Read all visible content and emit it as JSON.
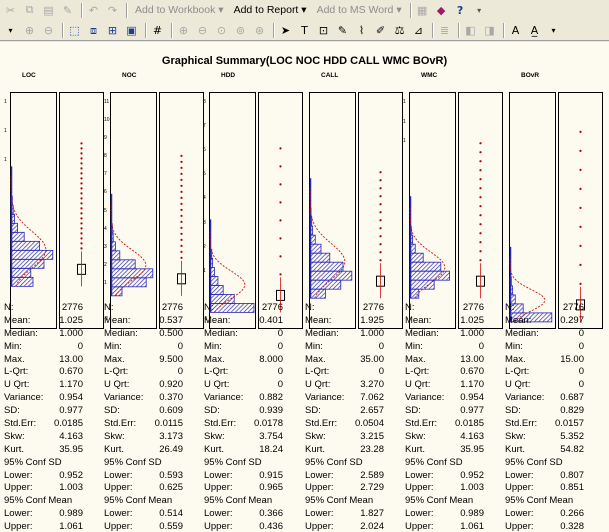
{
  "toolbar1": {
    "add_to_workbook": "Add to Workbook",
    "add_to_report": "Add to Report",
    "add_to_ms_word": "Add to MS Word"
  },
  "toolbar1_icons": [
    "cut-icon",
    "copy-icon",
    "paste-icon",
    "format-icon",
    "undo-icon",
    "redo-icon"
  ],
  "toolbar2_icons": [
    "dropdown-arrow-icon",
    "zoom-icon",
    "zoom-out-icon",
    "select-region-icon",
    "graph-icon",
    "graph-edit-icon",
    "grid-icon",
    "zoom-in-icon",
    "zoom-minus-icon",
    "zoom-fit-icon",
    "zoom-page-icon",
    "zoom-region-icon",
    "hash-icon",
    "pointer-icon",
    "text-icon",
    "insert-icon",
    "edit-icon",
    "brush-icon",
    "draw-icon",
    "scale-icon",
    "ruler-icon",
    "bars-icon",
    "layers-icon",
    "stack-icon",
    "font-up-icon",
    "font-down-icon"
  ],
  "graph": {
    "title": "Graphical Summary(LOC NOC HDD CALL WMC BOvR)",
    "colors": {
      "histogram": "#2727b8",
      "curve": "#d01010",
      "box": "#000000",
      "outlier": "#b00000"
    }
  },
  "panels": [
    {
      "label": "LOC",
      "ticks": [
        "1",
        "",
        "1",
        "",
        "1",
        "",
        "",
        "",
        "",
        "",
        "",
        "",
        "",
        "",
        "",
        ""
      ]
    },
    {
      "label": "NOC",
      "ticks": [
        "11",
        "10",
        "9",
        "8",
        "7",
        "6",
        "5",
        "4",
        "3",
        "2",
        "1",
        "",
        "-1"
      ]
    },
    {
      "label": "HDD",
      "ticks": [
        "8",
        "7",
        "6",
        "5",
        "4",
        "3",
        "2",
        "1",
        "",
        "-1"
      ]
    },
    {
      "label": "CALL",
      "ticks": [
        "",
        "",
        "",
        "",
        "",
        "",
        "",
        "",
        ""
      ]
    },
    {
      "label": "WMC",
      "ticks": [
        "1",
        "1",
        "1",
        "",
        "",
        "",
        "",
        "",
        "",
        "",
        "",
        ""
      ]
    },
    {
      "label": "BOvR",
      "ticks": [
        "",
        "",
        "",
        "",
        "",
        "",
        "",
        "",
        "",
        "",
        ""
      ]
    }
  ],
  "stat_labels": {
    "n": "N:",
    "mean": "Mean:",
    "median": "Median:",
    "min": "Min:",
    "max": "Max.",
    "lqrt": "L-Qrt:",
    "uqrt": "U Qrt:",
    "variance": "Variance:",
    "sd": "SD:",
    "stderr": "Std.Err:",
    "skw": "Skw:",
    "kurt": "Kurt.",
    "conf_sd": "95% Conf SD",
    "lower": "Lower:",
    "upper": "Upper:",
    "conf_mean": "95% Conf Mean"
  },
  "stats": [
    {
      "n": "2776",
      "mean": "1.025",
      "median": "1.000",
      "min": "0",
      "max": "13.00",
      "lqrt": "0.670",
      "uqrt": "1.170",
      "variance": "0.954",
      "sd": "0.977",
      "stderr": "0.0185",
      "skw": "4.163",
      "kurt": "35.95",
      "sd_lower": "0.952",
      "sd_upper": "1.003",
      "mean_lower": "0.989",
      "mean_upper": "1.061"
    },
    {
      "n": "2776",
      "mean": "0.537",
      "median": "0.500",
      "min": "0",
      "max": "9.500",
      "lqrt": "0",
      "uqrt": "0.920",
      "variance": "0.370",
      "sd": "0.609",
      "stderr": "0.0115",
      "skw": "3.173",
      "kurt": "26.49",
      "sd_lower": "0.593",
      "sd_upper": "0.625",
      "mean_lower": "0.514",
      "mean_upper": "0.559"
    },
    {
      "n": "2776",
      "mean": "0.401",
      "median": "0",
      "min": "0",
      "max": "8.000",
      "lqrt": "0",
      "uqrt": "0",
      "variance": "0.882",
      "sd": "0.939",
      "stderr": "0.0178",
      "skw": "3.754",
      "kurt": "18.24",
      "sd_lower": "0.915",
      "sd_upper": "0.965",
      "mean_lower": "0.366",
      "mean_upper": "0.436"
    },
    {
      "n": "2776",
      "mean": "1.925",
      "median": "1.000",
      "min": "0",
      "max": "35.00",
      "lqrt": "0",
      "uqrt": "3.270",
      "variance": "7.062",
      "sd": "2.657",
      "stderr": "0.0504",
      "skw": "3.215",
      "kurt": "23.28",
      "sd_lower": "2.589",
      "sd_upper": "2.729",
      "mean_lower": "1.827",
      "mean_upper": "2.024"
    },
    {
      "n": "2776",
      "mean": "1.025",
      "median": "1.000",
      "min": "0",
      "max": "13.00",
      "lqrt": "0.670",
      "uqrt": "1.170",
      "variance": "0.954",
      "sd": "0.977",
      "stderr": "0.0185",
      "skw": "4.163",
      "kurt": "35.95",
      "sd_lower": "0.952",
      "sd_upper": "1.003",
      "mean_lower": "0.989",
      "mean_upper": "1.061"
    },
    {
      "n": "2776",
      "mean": "0.297",
      "median": "0",
      "min": "0",
      "max": "15.00",
      "lqrt": "0",
      "uqrt": "0",
      "variance": "0.687",
      "sd": "0.829",
      "stderr": "0.0157",
      "skw": "5.352",
      "kurt": "54.82",
      "sd_lower": "0.807",
      "sd_upper": "0.851",
      "mean_lower": "0.266",
      "mean_upper": "0.328"
    }
  ]
}
